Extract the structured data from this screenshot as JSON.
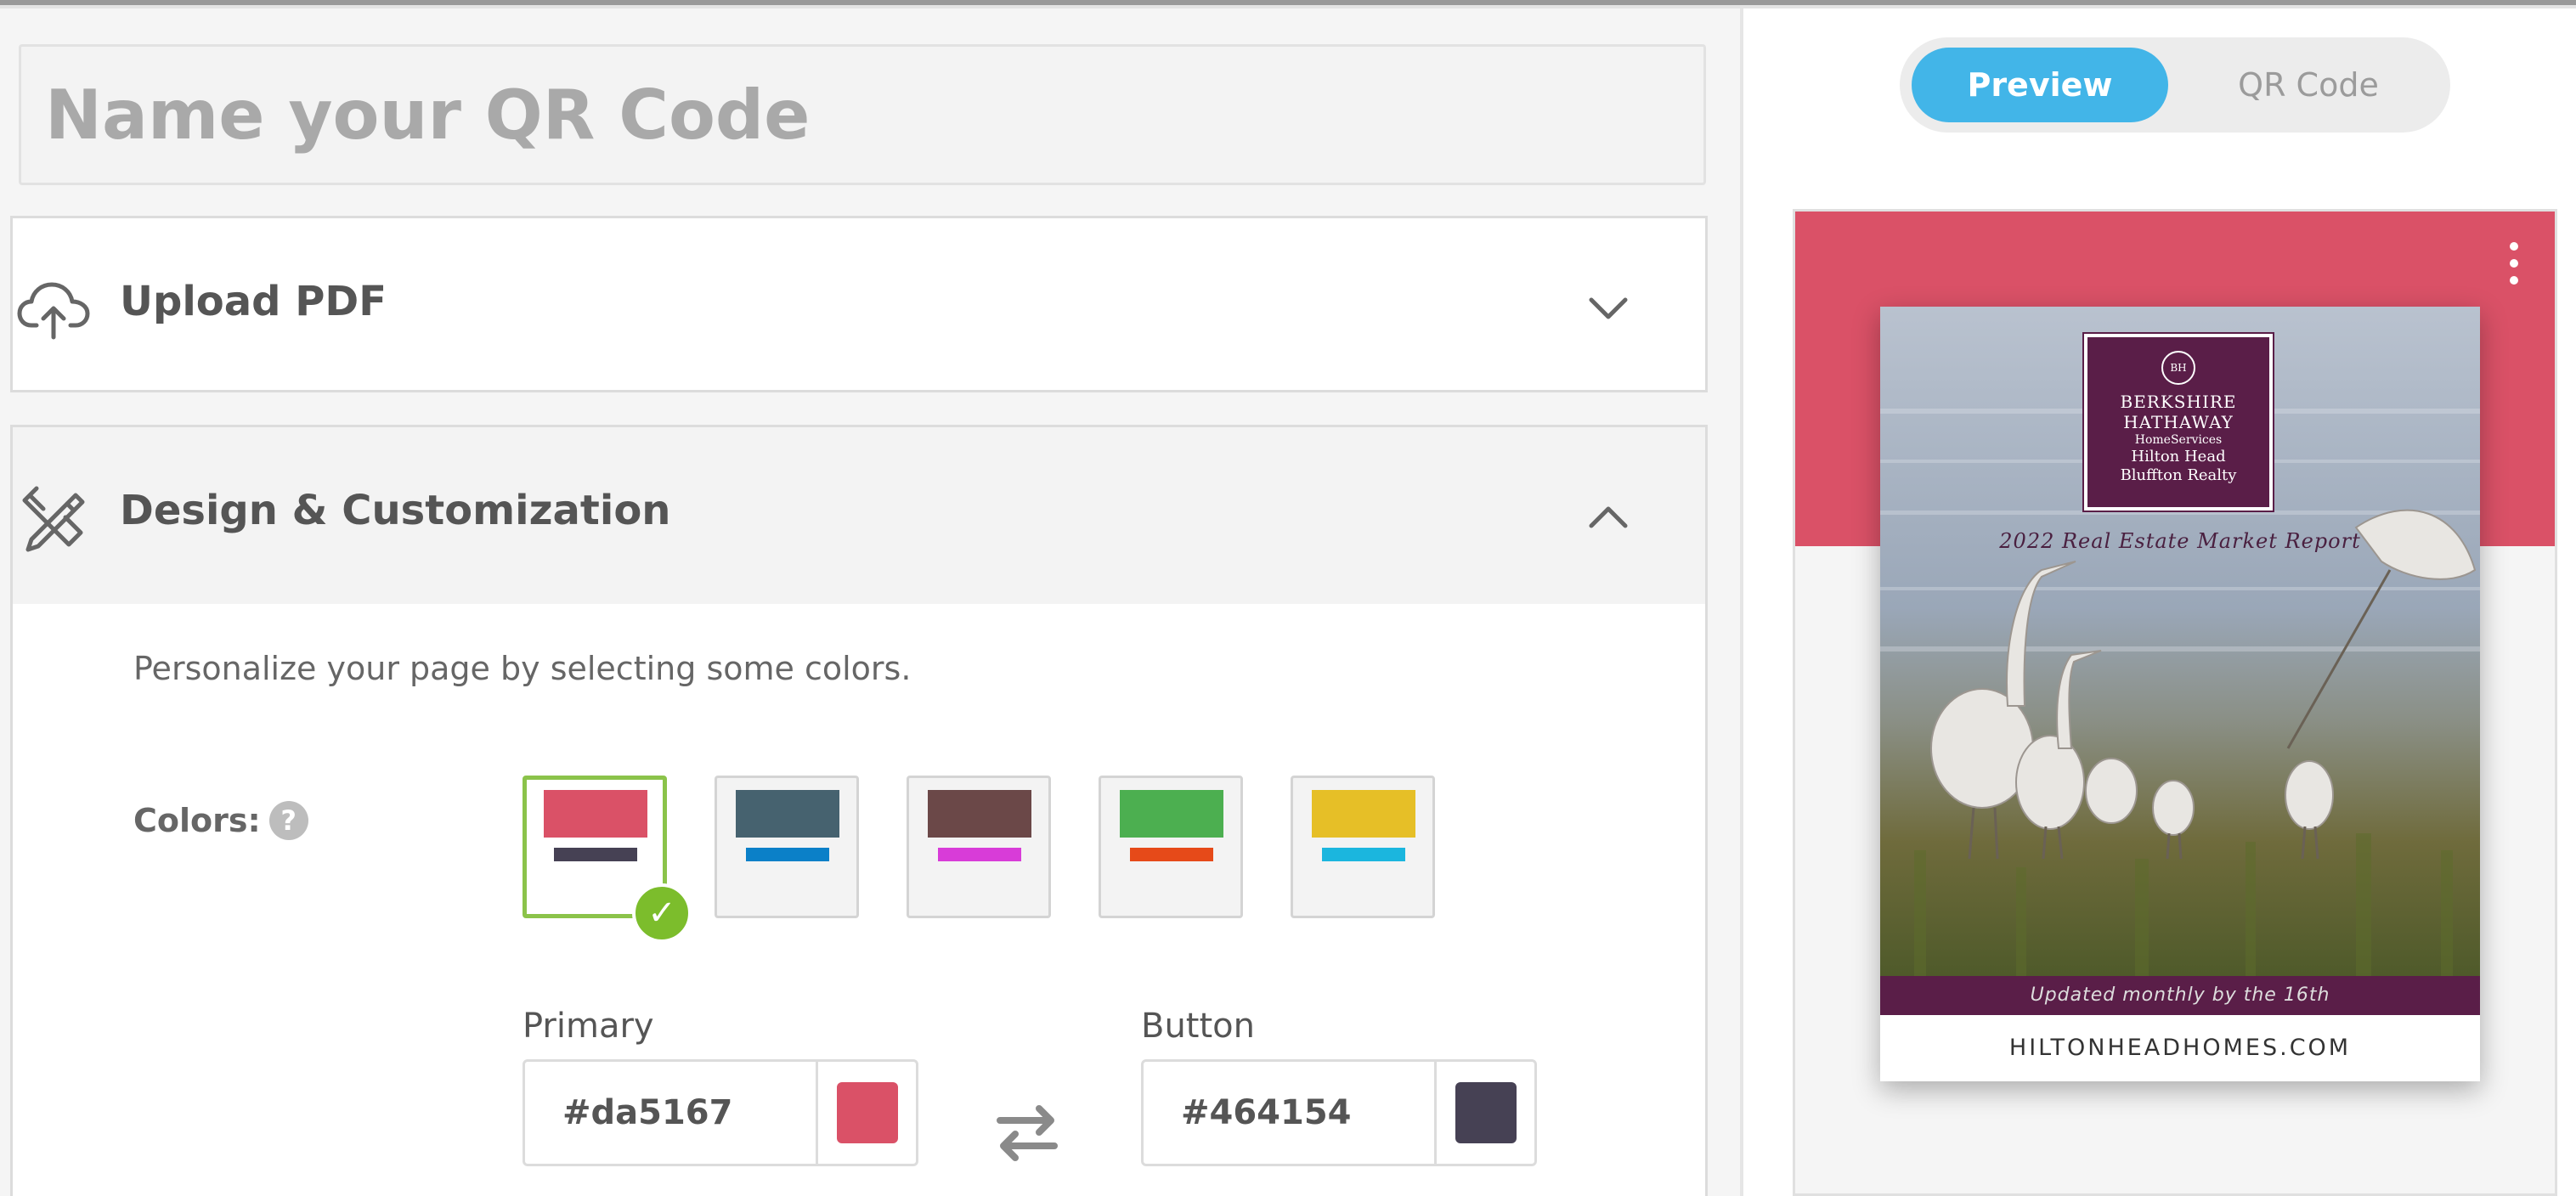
{
  "name_field": {
    "placeholder": "Name your QR Code",
    "value": ""
  },
  "sections": {
    "upload": {
      "title": "Upload PDF",
      "icon": "cloud-upload-icon",
      "state": "collapsed"
    },
    "design": {
      "title": "Design & Customization",
      "icon": "design-tools-icon",
      "state": "expanded",
      "help_text": "Personalize your page by selecting some colors.",
      "colors_label": "Colors:",
      "help_badge": "?",
      "palettes": [
        {
          "primary": "#da5167",
          "button": "#464154",
          "selected": true
        },
        {
          "primary": "#46626f",
          "button": "#0b80c8",
          "selected": false
        },
        {
          "primary": "#6b4848",
          "button": "#d83cd8",
          "selected": false
        },
        {
          "primary": "#4caf50",
          "button": "#e64a19",
          "selected": false
        },
        {
          "primary": "#e6bf27",
          "button": "#1bb6de",
          "selected": false
        }
      ],
      "check_mark": "✓",
      "primary_label": "Primary",
      "primary_value": "#da5167",
      "button_label": "Button",
      "button_value": "#464154"
    }
  },
  "preview": {
    "toggle": {
      "preview_label": "Preview",
      "qr_label": "QR Code",
      "active": "Preview"
    },
    "header_color": "#da5167",
    "pdf": {
      "logo_line1": "BERKSHIRE",
      "logo_line2": "HATHAWAY",
      "logo_line3": "HomeServices",
      "logo_line4": "Hilton Head",
      "logo_line5": "Bluffton Realty",
      "subtitle": "2022 Real Estate Market Report",
      "band_text": "Updated monthly by the 16th",
      "footer_text": "HILTONHEADHOMES.COM"
    }
  }
}
